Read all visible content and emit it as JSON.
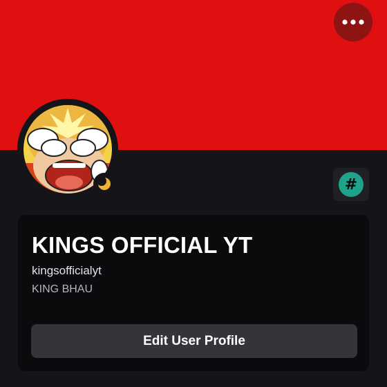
{
  "profile": {
    "display_name": "KINGS OFFICIAL YT",
    "username": "kingsofficialyt",
    "pronouns": "KING BHAU",
    "banner_color": "#e01010",
    "status": "idle"
  },
  "badge": {
    "symbol": "#",
    "icon": "hashtag-icon",
    "color": "#1fa38a"
  },
  "actions": {
    "more_icon": "more-horizontal-icon",
    "edit_profile_label": "Edit User Profile"
  }
}
